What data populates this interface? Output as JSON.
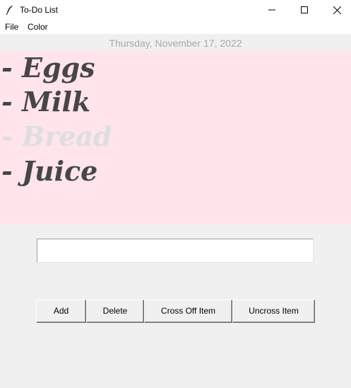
{
  "window": {
    "title": "To-Do List",
    "controls": {
      "minimize": "minimize",
      "maximize": "maximize",
      "close": "close"
    }
  },
  "menu": {
    "items": [
      {
        "label": "File"
      },
      {
        "label": "Color"
      }
    ]
  },
  "date": "Thursday, November 17, 2022",
  "list": {
    "background": "#ffe4ec",
    "text_color": "#464646",
    "crossed_color": "#dedede",
    "items": [
      {
        "label": "- Eggs",
        "crossed": false
      },
      {
        "label": "- Milk",
        "crossed": false
      },
      {
        "label": "- Bread",
        "crossed": true
      },
      {
        "label": "- Juice",
        "crossed": false
      }
    ]
  },
  "entry": {
    "value": "",
    "placeholder": ""
  },
  "buttons": {
    "add": "Add",
    "delete": "Delete",
    "cross_off": "Cross Off Item",
    "uncross": "Uncross Item"
  },
  "icons": {
    "app": "feather-icon",
    "minimize": "minimize-icon",
    "maximize": "maximize-icon",
    "close": "close-icon"
  }
}
